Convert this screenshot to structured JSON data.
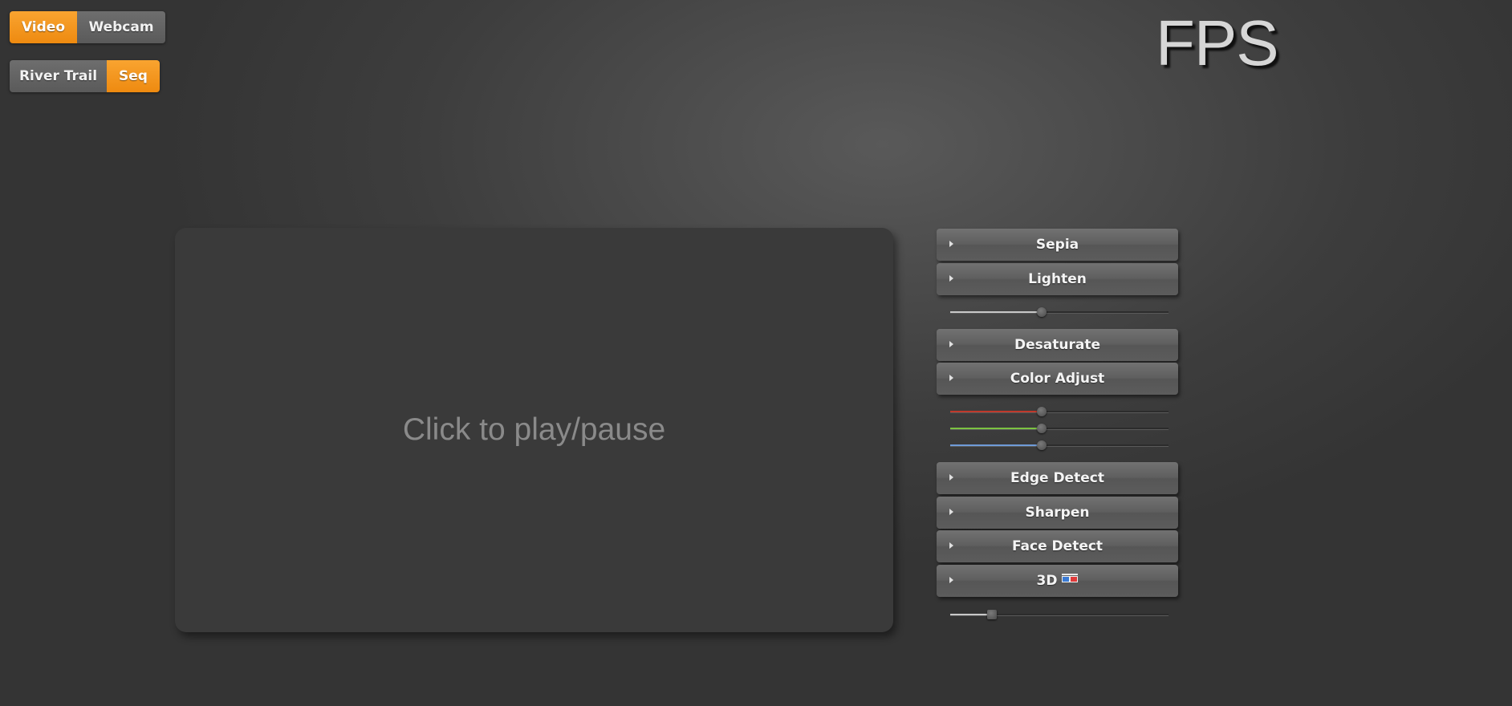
{
  "source_toggle": {
    "options": [
      {
        "label": "Video",
        "active": true
      },
      {
        "label": "Webcam",
        "active": false
      }
    ]
  },
  "clip_toggle": {
    "options": [
      {
        "label": "River Trail",
        "active": false
      },
      {
        "label": "Seq",
        "active": true
      }
    ]
  },
  "fps_label": "FPS",
  "video": {
    "hint": "Click to play/pause"
  },
  "filters": [
    {
      "label": "Sepia",
      "icon": "disclosure-triangle-icon"
    },
    {
      "label": "Lighten",
      "icon": "disclosure-triangle-icon"
    },
    {
      "label": "Desaturate",
      "icon": "disclosure-triangle-icon"
    },
    {
      "label": "Color Adjust",
      "icon": "disclosure-triangle-icon"
    },
    {
      "label": "Edge Detect",
      "icon": "disclosure-triangle-icon"
    },
    {
      "label": "Sharpen",
      "icon": "disclosure-triangle-icon"
    },
    {
      "label": "Face Detect",
      "icon": "disclosure-triangle-icon"
    },
    {
      "label": "3D",
      "icon": "disclosure-triangle-icon",
      "badge_icon": "3d-glasses-icon"
    }
  ],
  "sliders": {
    "lighten": {
      "value": 0.42,
      "color": "#c8c8c8"
    },
    "color_red": {
      "value": 0.42,
      "color": "#c0392b"
    },
    "color_green": {
      "value": 0.42,
      "color": "#7cc242"
    },
    "color_blue": {
      "value": 0.42,
      "color": "#6f9bd8"
    },
    "depth_3d": {
      "value": 0.19,
      "color": "#c8c8c8"
    }
  },
  "colors": {
    "accent": "#f39a1e",
    "panel": "#3a3a3a",
    "background": "#3f3f3f"
  }
}
